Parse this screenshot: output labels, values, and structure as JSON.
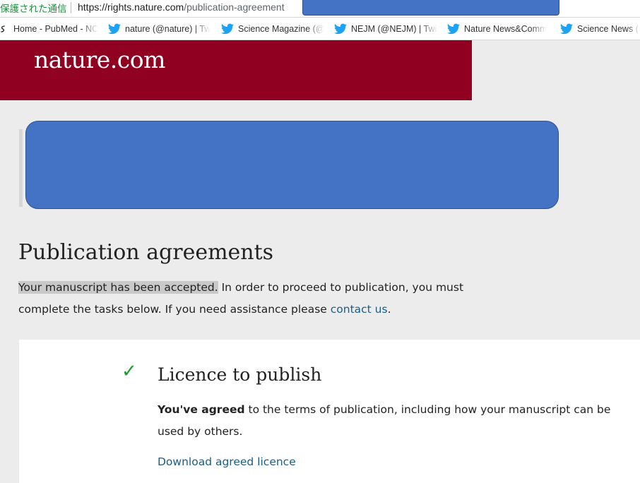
{
  "browser": {
    "secure_label": "保護された通信",
    "url_scheme_host": "https://rights.nature.com",
    "url_path": "/publication-agreement"
  },
  "bookmarks": [
    {
      "label": "Home - PubMed - NC",
      "icon": "ncbi-icon"
    },
    {
      "label": "nature (@nature) | Tw",
      "icon": "twitter-icon"
    },
    {
      "label": "Science Magazine (@",
      "icon": "twitter-icon"
    },
    {
      "label": "NEJM (@NEJM) | Twit",
      "icon": "twitter-icon"
    },
    {
      "label": "Nature News&Comm",
      "icon": "twitter-icon"
    },
    {
      "label": "Science News (@",
      "icon": "twitter-icon"
    }
  ],
  "header": {
    "logo": "nature.com"
  },
  "main": {
    "title": "Publication agreements",
    "intro_highlight": "Your manuscript has been accepted.",
    "intro_rest": " In order to proceed to publication, you must complete the tasks below. If you need assistance please ",
    "contact_link": "contact us",
    "intro_end": "."
  },
  "licence_card": {
    "check_icon": "checkmark-icon",
    "title": "Licence to publish",
    "agreed_bold": "You've agreed",
    "agreed_rest": " to the terms of publication, including how your manuscript can be used by others.",
    "download_link": "Download agreed licence"
  },
  "colors": {
    "brand": "#900021",
    "link": "#1a5d87",
    "check": "#1e9a2c",
    "redaction": "#4472c4"
  }
}
